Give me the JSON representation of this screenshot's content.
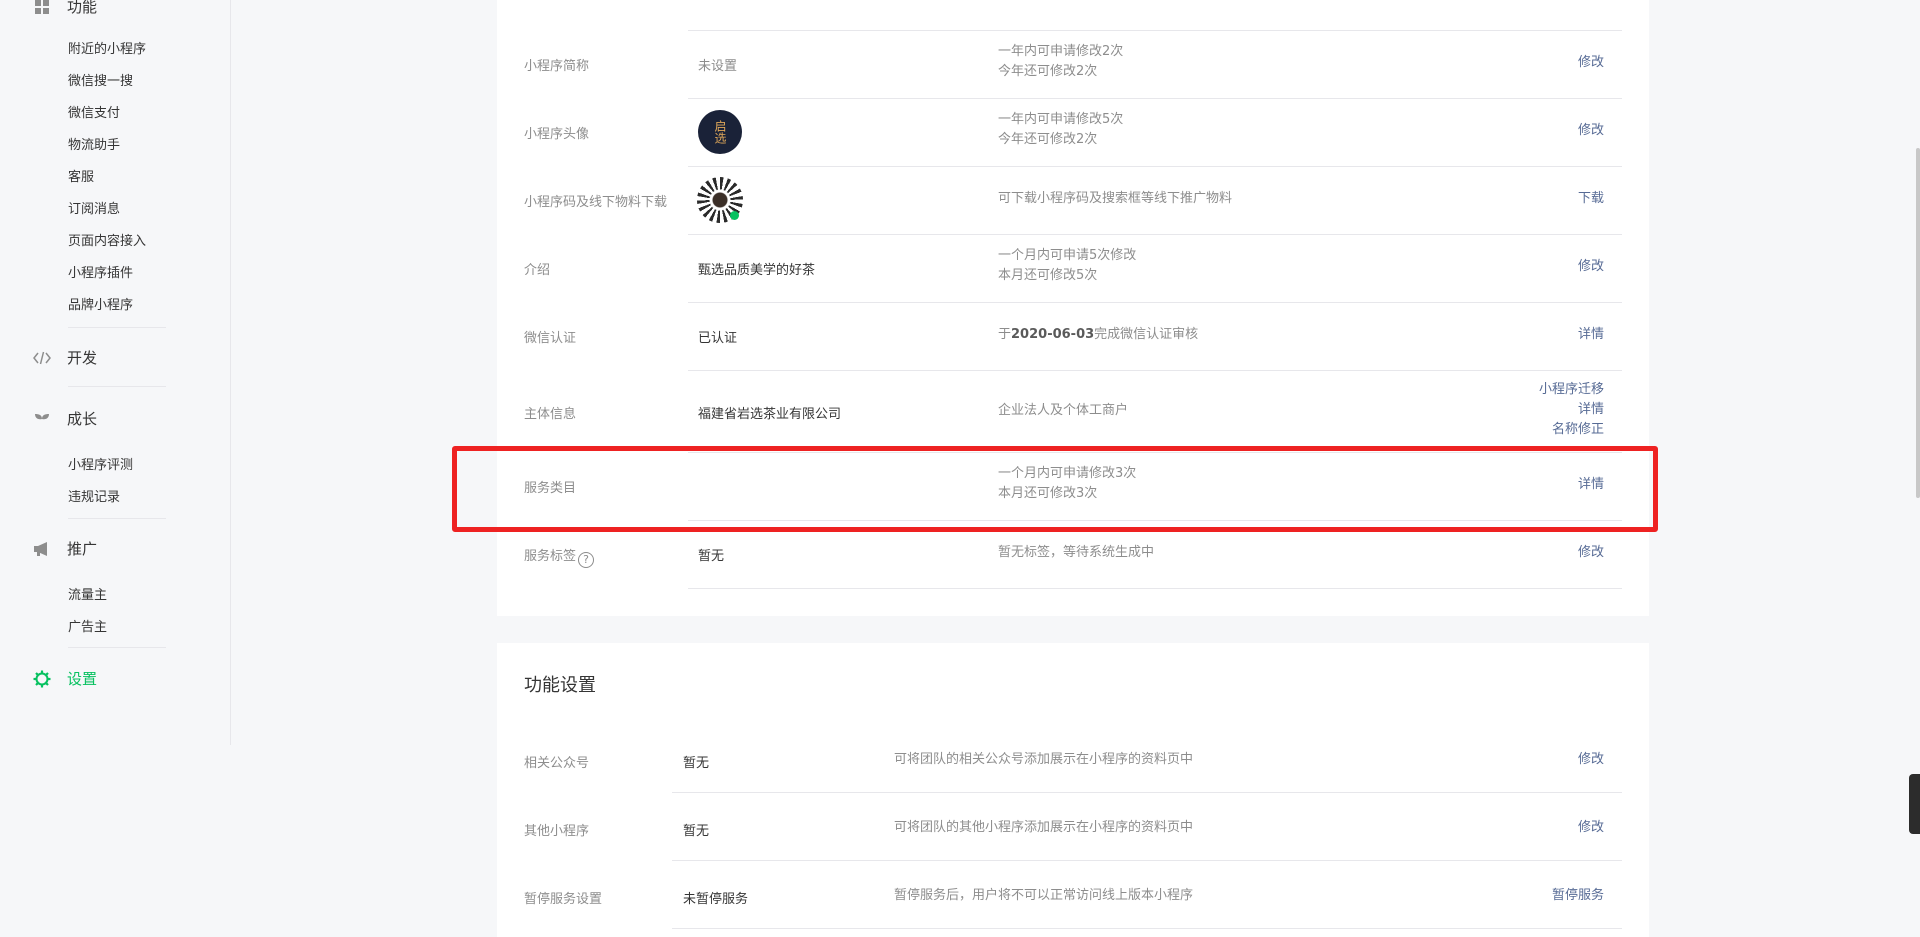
{
  "sidebar": {
    "func_title": "功能",
    "func_items": [
      "附近的小程序",
      "微信搜一搜",
      "微信支付",
      "物流助手",
      "客服",
      "订阅消息",
      "页面内容接入",
      "小程序插件",
      "品牌小程序"
    ],
    "dev_title": "开发",
    "growth_title": "成长",
    "growth_items": [
      "小程序评测",
      "违规记录"
    ],
    "promo_title": "推广",
    "promo_items": [
      "流量主",
      "广告主"
    ],
    "settings_title": "设置"
  },
  "basic_info": {
    "rows": [
      {
        "label": "小程序简称",
        "value": "未设置",
        "desc1": "一年内可申请修改2次",
        "desc2": "今年还可修改2次",
        "action": "修改"
      },
      {
        "label": "小程序头像",
        "avatar_text": "启选",
        "desc1": "一年内可申请修改5次",
        "desc2": "今年还可修改2次",
        "action": "修改"
      },
      {
        "label": "小程序码及线下物料下载",
        "desc1": "可下载小程序码及搜索框等线下推广物料",
        "action": "下载"
      },
      {
        "label": "介绍",
        "value": "甄选品质美学的好茶",
        "desc1": "一个月内可申请5次修改",
        "desc2": "本月还可修改5次",
        "action": "修改"
      },
      {
        "label": "微信认证",
        "value": "已认证",
        "desc_prefix": "于",
        "desc_bold": "2020-06-03",
        "desc_suffix": "完成微信认证审核",
        "action": "详情"
      },
      {
        "label": "主体信息",
        "value": "福建省岩选茶业有限公司",
        "desc1": "企业法人及个体工商户",
        "actions": [
          "小程序迁移",
          "详情",
          "名称修正"
        ]
      },
      {
        "label": "服务类目",
        "desc1": "一个月内可申请修改3次",
        "desc2": "本月还可修改3次",
        "action": "详情"
      },
      {
        "label": "服务标签",
        "help": "?",
        "value": "暂无",
        "desc1": "暂无标签，等待系统生成中",
        "action": "修改"
      }
    ]
  },
  "func_settings": {
    "title": "功能设置",
    "rows": [
      {
        "label": "相关公众号",
        "value": "暂无",
        "desc": "可将团队的相关公众号添加展示在小程序的资料页中",
        "action": "修改"
      },
      {
        "label": "其他小程序",
        "value": "暂无",
        "desc": "可将团队的其他小程序添加展示在小程序的资料页中",
        "action": "修改"
      },
      {
        "label": "暂停服务设置",
        "value": "未暂停服务",
        "desc": "暂停服务后，用户将不可以正常访问线上版本小程序",
        "action": "暂停服务"
      }
    ]
  }
}
